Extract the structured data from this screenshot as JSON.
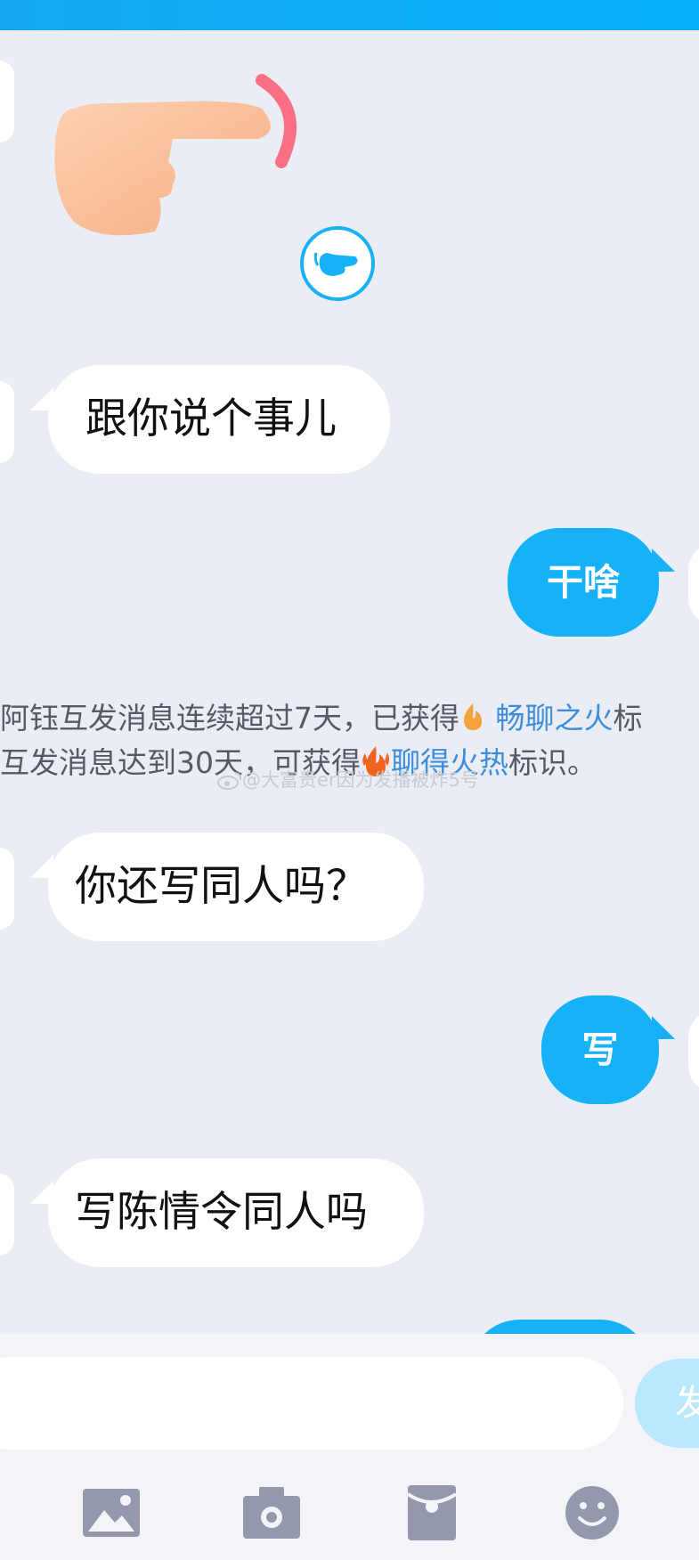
{
  "colors": {
    "background": "#ebedf5",
    "top_bar": "#06b2fb",
    "bubble_sent": "#16b1f7",
    "bubble_received": "#ffffff",
    "highlight_link": "#3e8ddb",
    "icon_gray": "#9498ac"
  },
  "messages": [
    {
      "side": "received",
      "type": "sticker",
      "sticker_icon": "pointing-hand-icon",
      "badge_icon": "pointing-hand-badge-icon"
    },
    {
      "side": "received",
      "type": "text",
      "text": "跟你说个事儿"
    },
    {
      "side": "sent",
      "type": "text",
      "text": "干啥"
    },
    {
      "side": "received",
      "type": "text",
      "text": "你还写同人吗？"
    },
    {
      "side": "sent",
      "type": "text",
      "text": "写"
    },
    {
      "side": "received",
      "type": "text",
      "text": "写陈情令同人吗"
    }
  ],
  "notice": {
    "line1_prefix": "阿钰互发消息连续超过7天，已获得",
    "line1_badge": "畅聊之火",
    "line1_suffix": "标",
    "line2_prefix": "互发消息达到30天，可获得",
    "line2_badge": "聊得火热",
    "line2_suffix": "标识。",
    "fire_icon": "flame-icon",
    "double_fire_icon": "double-flame-icon"
  },
  "watermark": {
    "text": "@大富贵er因为发播被炸5号",
    "icon": "weibo-logo-icon"
  },
  "compose": {
    "input_value": "",
    "send_label": "发"
  },
  "toolbar": {
    "items": [
      {
        "icon": "image-icon"
      },
      {
        "icon": "camera-icon"
      },
      {
        "icon": "red-packet-icon"
      },
      {
        "icon": "emoji-icon"
      }
    ]
  }
}
